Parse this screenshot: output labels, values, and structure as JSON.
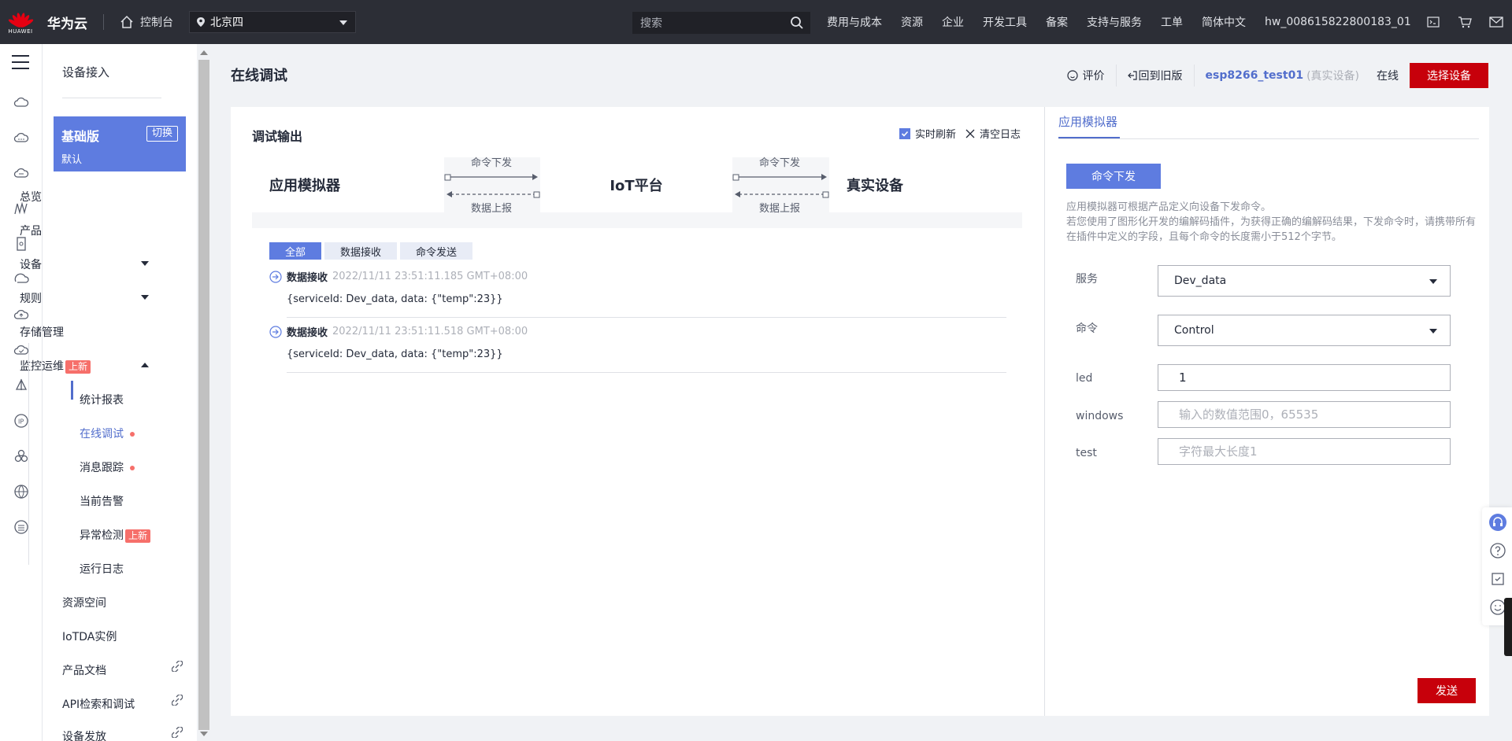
{
  "topbar": {
    "logo_text": "HUAWEI",
    "brand": "华为云",
    "console": "控制台",
    "region": "北京四",
    "search_placeholder": "搜索",
    "nav": [
      "费用与成本",
      "资源",
      "企业",
      "开发工具",
      "备案",
      "支持与服务",
      "工单",
      "简体中文",
      "hw_008615822800183_01"
    ]
  },
  "menu": {
    "title": "设备接入",
    "edition": {
      "name": "基础版",
      "default": "默认",
      "switch": "切换"
    },
    "items": {
      "overview": "总览",
      "product": "产品",
      "device": "设备",
      "rules": "规则",
      "storage": "存储管理",
      "monitor": "监控运维",
      "monitor_badge": "上新",
      "resource_space": "资源空间",
      "iotda": "IoTDA实例",
      "product_docs": "产品文档",
      "api": "API检索和调试",
      "provision": "设备发放"
    },
    "subitems": {
      "stats": "统计报表",
      "debug": "在线调试",
      "trace": "消息跟踪",
      "alarm": "当前告警",
      "anomaly": "异常检测",
      "anomaly_badge": "上新",
      "log": "运行日志"
    }
  },
  "page": {
    "title": "在线调试",
    "rate": "评价",
    "back_old": "回到旧版",
    "device_name": "esp8266_test01",
    "device_tag": "(真实设备)",
    "status": "在线",
    "select_device": "选择设备"
  },
  "output": {
    "title": "调试输出",
    "realtime": "实时刷新",
    "clear": "清空日志",
    "flow": {
      "app": "应用模拟器",
      "platform": "IoT平台",
      "device": "真实设备",
      "cmd_down": "命令下发",
      "data_up": "数据上报"
    },
    "tabs": [
      "全部",
      "数据接收",
      "命令发送"
    ],
    "logs": [
      {
        "type": "数据接收",
        "time": "2022/11/11 23:51:11.185 GMT+08:00",
        "body": "{serviceId: Dev_data, data: {\"temp\":23}}"
      },
      {
        "type": "数据接收",
        "time": "2022/11/11 23:51:11.518 GMT+08:00",
        "body": "{serviceId: Dev_data, data: {\"temp\":23}}"
      }
    ]
  },
  "simulator": {
    "tab": "应用模拟器",
    "cmd_button": "命令下发",
    "desc_1": "应用模拟器可根据产品定义向设备下发命令。",
    "desc_2": "若您使用了图形化开发的编解码插件，为获得正确的编解码结果，下发命令时，请携带所有在插件中定义的字段，且每个命令的长度需小于512个字节。",
    "service_label": "服务",
    "service_value": "Dev_data",
    "command_label": "命令",
    "command_value": "Control",
    "led_label": "led",
    "led_value": "1",
    "windows_label": "windows",
    "windows_placeholder": "输入的数值范围0，65535",
    "test_label": "test",
    "test_placeholder": "字符最大长度1",
    "send": "发送"
  },
  "colors": {
    "accent": "#5e7ce0",
    "brand_red": "#c7000b",
    "badge_red": "#f66f6a",
    "topbar": "#2c2e36"
  }
}
